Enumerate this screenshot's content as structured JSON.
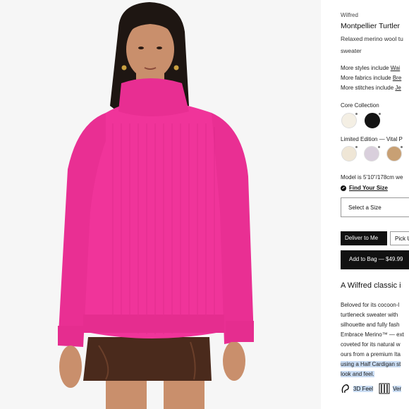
{
  "product": {
    "brand": "Wilfred",
    "title": "Montpellier Turtler",
    "description": "Relaxed merino wool tu sweater"
  },
  "more_links": [
    {
      "prefix": "More styles include ",
      "link": "Wai"
    },
    {
      "prefix": "More fabrics include ",
      "link": "Bre"
    },
    {
      "prefix": "More stitches include ",
      "link": "Je"
    }
  ],
  "core_collection": {
    "label": "Core Collection",
    "swatches": [
      {
        "color": "#f4efe4"
      },
      {
        "color": "#141414"
      }
    ]
  },
  "limited_edition": {
    "label": "Limited Edition — Vital P",
    "swatches": [
      {
        "color": "#efe6d6"
      },
      {
        "color": "#d9cfdc"
      },
      {
        "color": "#c8a074"
      }
    ]
  },
  "model_info": "Model is 5'10\"/178cm we",
  "find_size": "Find Your Size",
  "size_select": "Select a Size",
  "delivery": {
    "deliver": "Deliver to Me",
    "pickup": "Pick U"
  },
  "add_to_bag": "Add to Bag — $49.99",
  "classic_heading": "A Wilfred classic i",
  "body_lines": [
    {
      "text": "Beloved for its cocoon-l",
      "highlight": false
    },
    {
      "text": "turtleneck sweater with",
      "highlight": false
    },
    {
      "text": "silhouette and fully fash",
      "highlight": false
    },
    {
      "text": "Embrace Merino™ — ext",
      "highlight": false
    },
    {
      "text": "coveted for its natural w",
      "highlight": false
    },
    {
      "text": "ours from a premium Ita",
      "highlight": false
    },
    {
      "text": "using a Half Cardigan st",
      "highlight": true
    },
    {
      "text": "look and feel.",
      "highlight": true
    }
  ],
  "features": [
    {
      "icon": "3d-feel-icon",
      "label": "3D Feel"
    },
    {
      "icon": "vertical-stitch-icon",
      "label": "Ver"
    }
  ],
  "colors": {
    "sweater": "#f0349a",
    "skirt": "#4a2a1c",
    "skin": "#c98f6c",
    "hair": "#1e1612",
    "button_dark": "#111111",
    "highlight": "#c9dcf3"
  }
}
